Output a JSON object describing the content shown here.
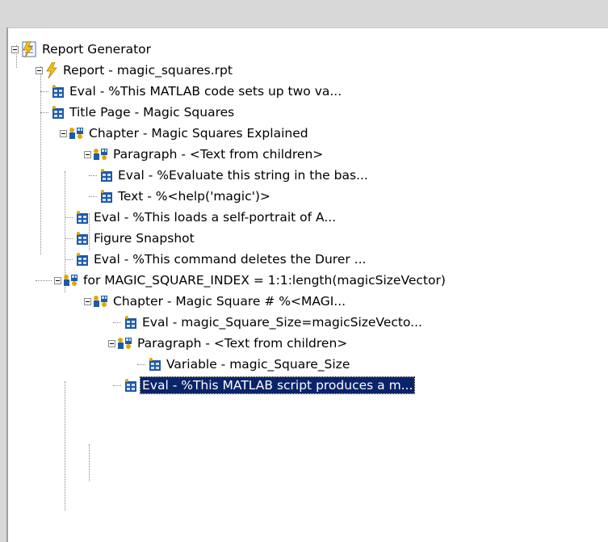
{
  "tree": {
    "root": {
      "label": "Report Generator",
      "icon": "report-generator-icon"
    },
    "report": {
      "label": "Report - magic_squares.rpt",
      "icon": "lightning-icon"
    },
    "items": [
      {
        "label": "Eval - %This MATLAB code sets up two va...",
        "icon": "component-table-icon"
      },
      {
        "label": "Title Page - Magic Squares",
        "icon": "component-table-icon"
      },
      {
        "label": "Chapter - Magic Squares Explained",
        "icon": "component-group-icon"
      },
      {
        "label": "Paragraph - <Text from children>",
        "icon": "component-group-icon"
      },
      {
        "label": "Eval - %Evaluate this string in the bas...",
        "icon": "component-table-icon"
      },
      {
        "label": "Text - %<help('magic')>",
        "icon": "component-table-icon"
      },
      {
        "label": "Eval - %This loads a self-portrait of A...",
        "icon": "component-table-icon"
      },
      {
        "label": "Figure Snapshot",
        "icon": "component-table-icon"
      },
      {
        "label": "Eval - %This command deletes the Durer ...",
        "icon": "component-table-icon"
      },
      {
        "label": "for MAGIC_SQUARE_INDEX = 1:1:length(magicSizeVector)",
        "icon": "component-group-icon"
      },
      {
        "label": "Chapter - Magic Square # %<MAGI...",
        "icon": "component-group-icon"
      },
      {
        "label": "Eval - magic_Square_Size=magicSizeVecto...",
        "icon": "component-table-icon"
      },
      {
        "label": "Paragraph - <Text from children>",
        "icon": "component-group-icon"
      },
      {
        "label": "Variable - magic_Square_Size",
        "icon": "component-table-icon"
      },
      {
        "label": "Eval - %This MATLAB script produces a m...",
        "icon": "component-table-icon",
        "selected": true
      }
    ]
  },
  "colors": {
    "selection": "#0a246a",
    "icon_blue": "#1e5aa8",
    "icon_gold": "#e0a800"
  }
}
